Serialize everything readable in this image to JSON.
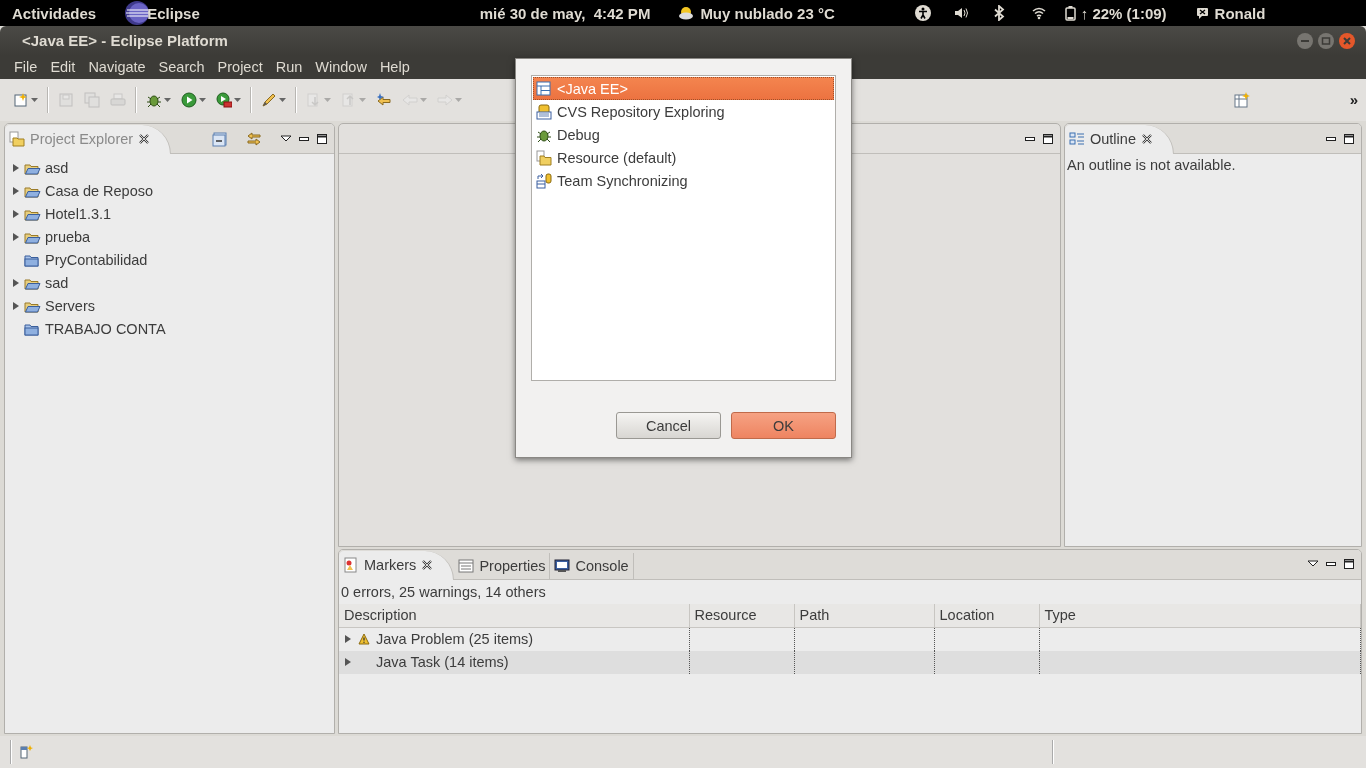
{
  "top_panel": {
    "activities": "Actividades",
    "app_name": "Eclipse",
    "clock": "mié 30 de may,  4:42 PM",
    "weather": "Muy nublado 23 °C",
    "battery": "↑ 22% (1:09)",
    "user": "Ronald"
  },
  "window": {
    "title": "<Java EE> - Eclipse Platform"
  },
  "menu": [
    "File",
    "Edit",
    "Navigate",
    "Search",
    "Project",
    "Run",
    "Window",
    "Help"
  ],
  "toolbar": [
    {
      "kind": "new",
      "disabled": false,
      "dropdown": true
    },
    {
      "kind": "separator"
    },
    {
      "kind": "save",
      "disabled": true,
      "dropdown": false
    },
    {
      "kind": "save-all",
      "disabled": true,
      "dropdown": false
    },
    {
      "kind": "print",
      "disabled": true,
      "dropdown": false
    },
    {
      "kind": "separator"
    },
    {
      "kind": "debug",
      "disabled": false,
      "dropdown": true
    },
    {
      "kind": "run",
      "disabled": false,
      "dropdown": true
    },
    {
      "kind": "external-tools",
      "disabled": false,
      "dropdown": true
    },
    {
      "kind": "separator"
    },
    {
      "kind": "pen",
      "disabled": false,
      "dropdown": true
    },
    {
      "kind": "separator"
    },
    {
      "kind": "next-annotation",
      "disabled": true,
      "dropdown": true
    },
    {
      "kind": "previous-annotation",
      "disabled": true,
      "dropdown": true
    },
    {
      "kind": "last-edit",
      "disabled": false,
      "dropdown": false
    },
    {
      "kind": "back",
      "disabled": true,
      "dropdown": true
    },
    {
      "kind": "forward",
      "disabled": true,
      "dropdown": true
    }
  ],
  "toolbar_more": "»",
  "project_explorer": {
    "title": "Project Explorer",
    "items": [
      {
        "label": "asd",
        "kind": "folder",
        "expandable": true
      },
      {
        "label": "Casa de Reposo",
        "kind": "folder",
        "expandable": true
      },
      {
        "label": "Hotel1.3.1",
        "kind": "folder",
        "expandable": true
      },
      {
        "label": "prueba",
        "kind": "folder",
        "expandable": true
      },
      {
        "label": "PryContabilidad",
        "kind": "project",
        "expandable": false
      },
      {
        "label": "sad",
        "kind": "folder",
        "expandable": true
      },
      {
        "label": "Servers",
        "kind": "folder",
        "expandable": true
      },
      {
        "label": "TRABAJO CONTA",
        "kind": "project",
        "expandable": false
      }
    ]
  },
  "outline": {
    "title": "Outline",
    "message": "An outline is not available."
  },
  "bottom_tabs": [
    {
      "label": "Markers",
      "kind": "markers",
      "selected": true
    },
    {
      "label": "Properties",
      "kind": "properties",
      "selected": false
    },
    {
      "label": "Console",
      "kind": "console",
      "selected": false
    }
  ],
  "markers": {
    "summary": "0 errors, 25 warnings, 14 others",
    "columns": [
      "Description",
      "Resource",
      "Path",
      "Location",
      "Type"
    ],
    "rows": [
      {
        "description": "Java Problem (25 items)",
        "kind": "warning"
      },
      {
        "description": "Java Task (14 items)",
        "kind": "task"
      }
    ]
  },
  "dialog": {
    "items": [
      {
        "label": "<Java EE>",
        "kind": "javaee",
        "selected": true
      },
      {
        "label": "CVS Repository Exploring",
        "kind": "cvs",
        "selected": false
      },
      {
        "label": "Debug",
        "kind": "debug",
        "selected": false
      },
      {
        "label": "Resource (default)",
        "kind": "resource",
        "selected": false
      },
      {
        "label": "Team Synchronizing",
        "kind": "team",
        "selected": false
      }
    ],
    "buttons": [
      {
        "label": "Cancel",
        "default": false
      },
      {
        "label": "OK",
        "default": true
      }
    ]
  }
}
